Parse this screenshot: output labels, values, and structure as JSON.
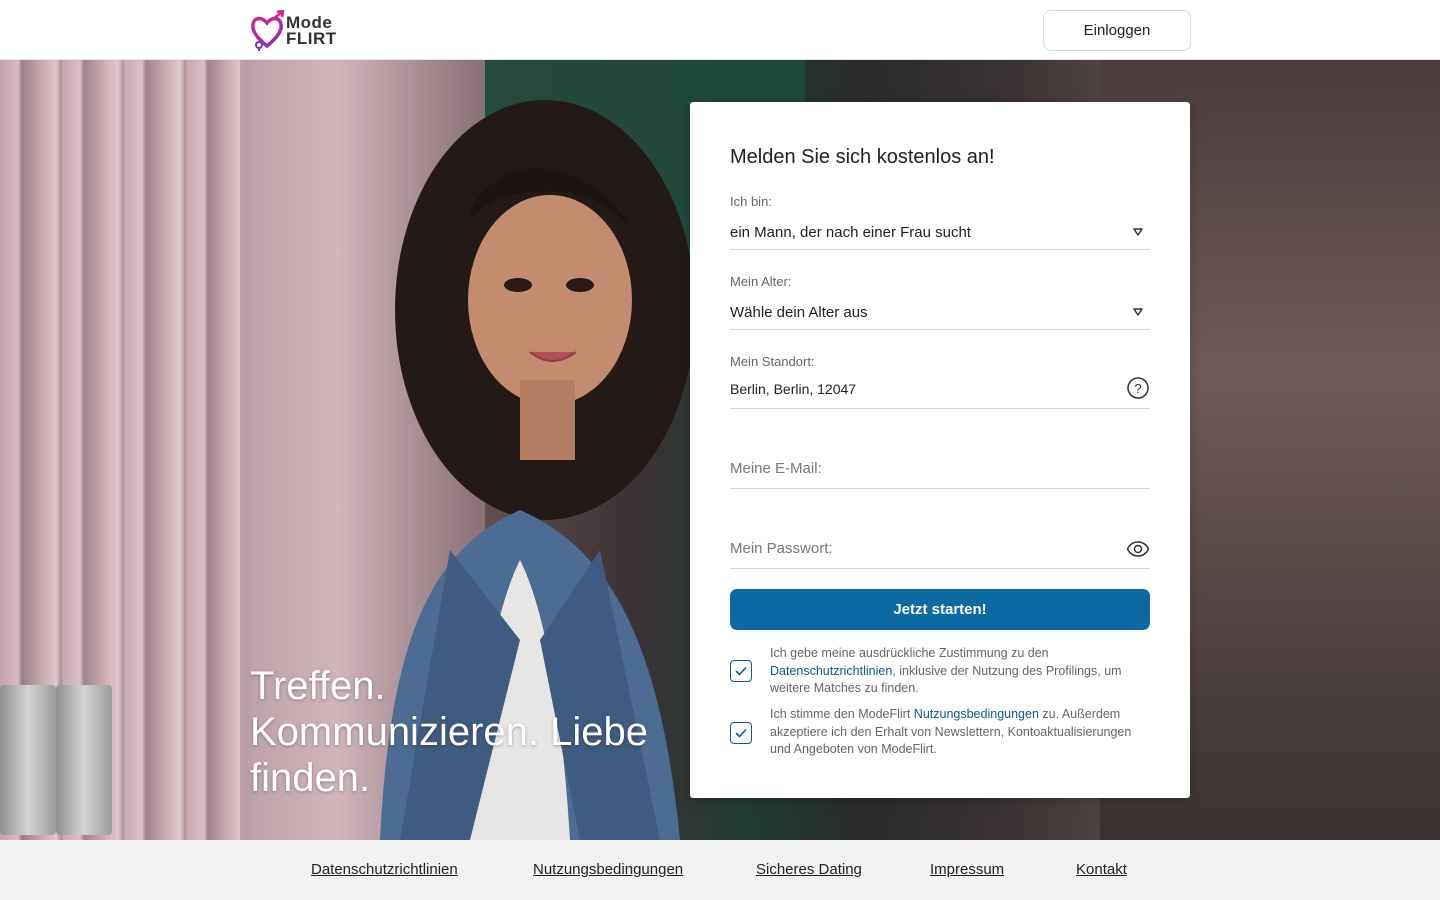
{
  "header": {
    "logo_line1": "Mode",
    "logo_line2": "FLIRT",
    "login_label": "Einloggen"
  },
  "hero": {
    "tagline_line1": "Treffen.",
    "tagline_line2": "Kommunizieren. Liebe",
    "tagline_line3": "finden."
  },
  "form": {
    "title": "Melden Sie sich kostenlos an!",
    "gender": {
      "label": "Ich bin:",
      "value": "ein Mann, der nach einer Frau sucht"
    },
    "age": {
      "label": "Mein Alter:",
      "value": "Wähle dein Alter aus"
    },
    "location": {
      "label": "Mein Standort:",
      "value": "Berlin, Berlin, 12047"
    },
    "email": {
      "placeholder": "Meine E-Mail:"
    },
    "password": {
      "placeholder": "Mein Passwort:"
    },
    "submit_label": "Jetzt starten!",
    "consent1": {
      "text_before": "Ich gebe meine ausdrückliche Zustimmung zu den ",
      "link": "Datenschutzrichtlinien",
      "text_after": ", inklusive der Nutzung des Profilings, um weitere Matches zu finden.",
      "checked": true
    },
    "consent2": {
      "text_before": "Ich stimme den ModeFlirt ",
      "link": "Nutzungsbedingungen",
      "text_after": " zu. Außerdem akzeptiere ich den Erhalt von Newslettern, Kontoaktualisierungen und Angeboten von ModeFlirt.",
      "checked": true
    }
  },
  "footer": {
    "links": [
      "Datenschutzrichtlinien",
      "Nutzungsbedingungen",
      "Sicheres Dating",
      "Impressum",
      "Kontakt"
    ]
  },
  "colors": {
    "primary": "#0b6aa2",
    "link": "#0b5a8f",
    "logo_pink": "#e0208a",
    "logo_purple": "#7b2fbf"
  }
}
